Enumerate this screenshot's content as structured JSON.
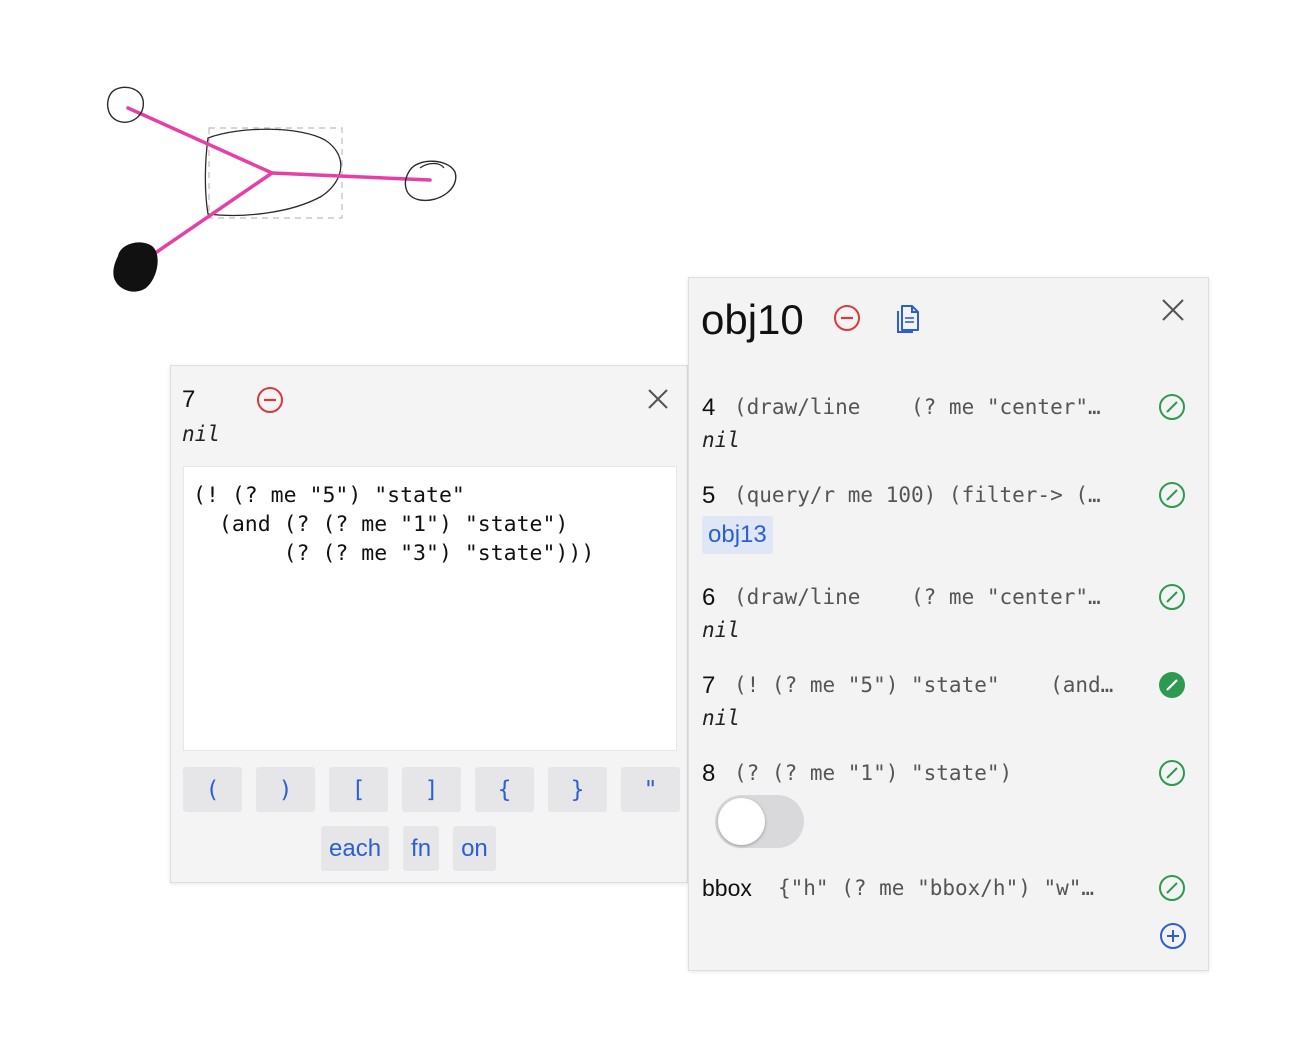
{
  "canvas": {
    "stroke_color": "#e83fa6",
    "sketch_color": "#222222"
  },
  "editor": {
    "line_number": "7",
    "result": "nil",
    "remove_icon": "minus-circle-icon",
    "close_icon": "close-icon",
    "code_lines": [
      "(! (? me \"5\") \"state\"",
      "  (and (? (? me \"1\") \"state\")",
      "       (? (? me \"3\") \"state\")))"
    ],
    "keys_row1": [
      "(",
      ")",
      "[",
      "]",
      "{",
      "}",
      "\""
    ],
    "keys_row2": [
      "each",
      "fn",
      "on"
    ]
  },
  "object_panel": {
    "title": "obj10",
    "accent_color": "#2c5fd1",
    "remove_color": "#d93a3a",
    "check_color": "#2e9a4f",
    "rows": [
      {
        "num": "4",
        "expr": "(draw/line    (? me \"center\"…",
        "result": "nil",
        "active": false
      },
      {
        "num": "5",
        "expr": "(query/r me 100) (filter-> (…",
        "chip": "obj13",
        "active": false
      },
      {
        "num": "6",
        "expr": "(draw/line    (? me \"center\"…",
        "result": "nil",
        "active": false
      },
      {
        "num": "7",
        "expr": "(! (? me \"5\") \"state\"    (and…",
        "result": "nil",
        "active": true
      },
      {
        "num": "8",
        "expr": "(? (? me \"1\") \"state\")",
        "toggle_on": false,
        "active": false
      }
    ],
    "bbox": {
      "label": "bbox",
      "expr": "{\"h\" (? me \"bbox/h\") \"w\"…"
    }
  }
}
